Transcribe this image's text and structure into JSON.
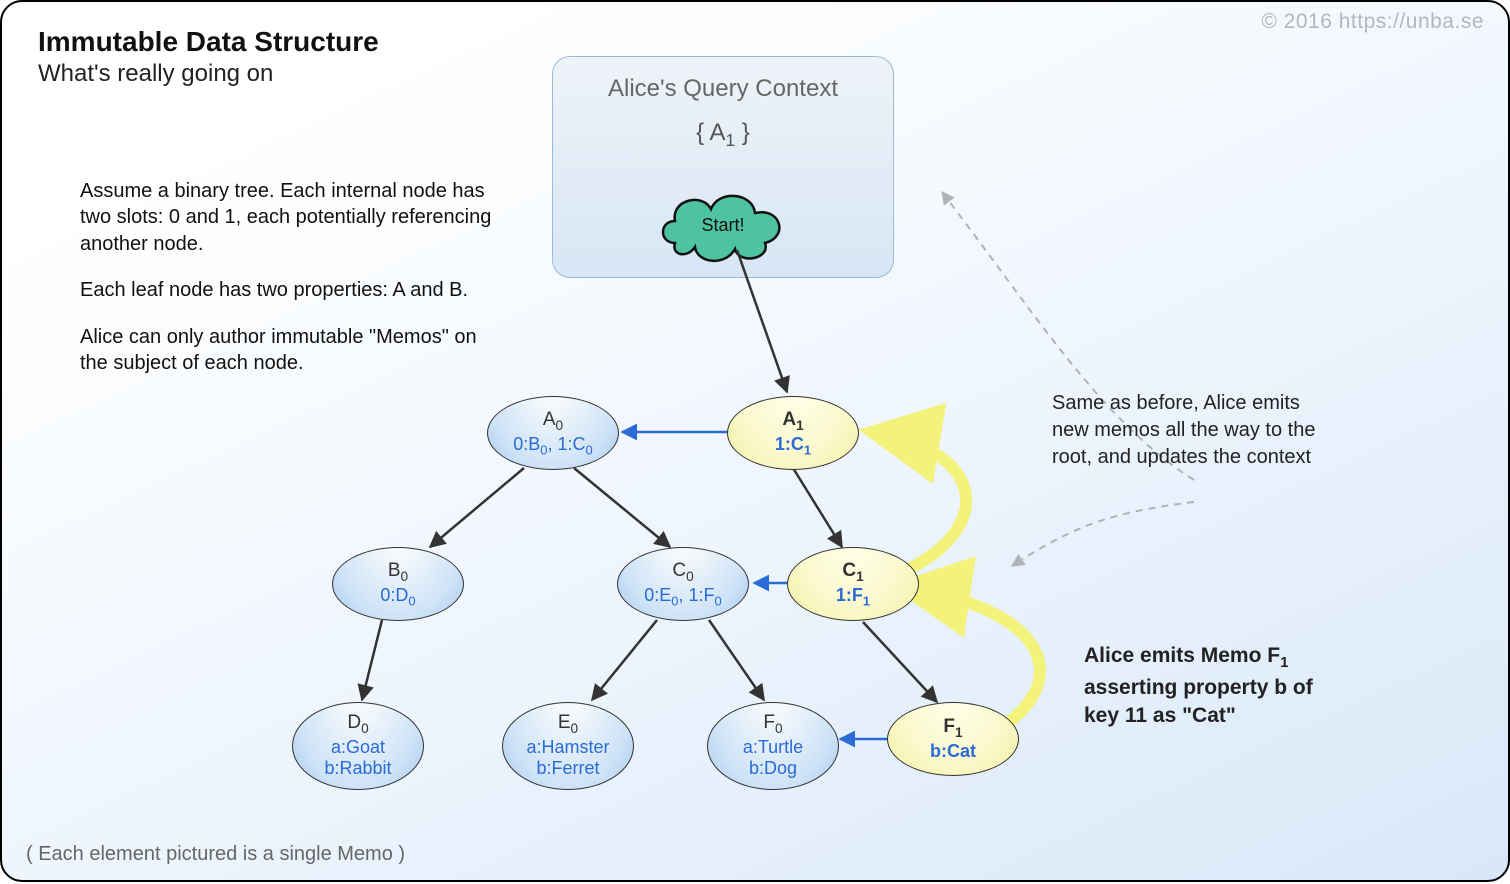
{
  "copyright": "© 2016  https://unba.se",
  "title": "Immutable Data Structure",
  "subtitle": "What's really going on",
  "desc": {
    "p1": "Assume a binary tree. Each internal node has two slots: 0 and 1, each potentially referencing another node.",
    "p2": "Each leaf node has two properties: A and B.",
    "p3": "Alice can only author immutable \"Memos\" on the subject of each node."
  },
  "footnote": "( Each element pictured is a single Memo )",
  "query_context": {
    "title": "Alice's Query Context",
    "set_html": "{ A<sub>1</sub> }",
    "start_label": "Start!"
  },
  "nodes": {
    "a0": {
      "label_html": "A<sub>0</sub>",
      "sub_html": "0:B<sub>0</sub>, 1:C<sub>0</sub>"
    },
    "a1": {
      "label_html": "A<sub>1</sub>",
      "sub_html": "1:C<sub>1</sub>"
    },
    "b0": {
      "label_html": "B<sub>0</sub>",
      "sub_html": "0:D<sub>0</sub>"
    },
    "c0": {
      "label_html": "C<sub>0</sub>",
      "sub_html": "0:E<sub>0</sub>, 1:F<sub>0</sub>"
    },
    "c1": {
      "label_html": "C<sub>1</sub>",
      "sub_html": "1:F<sub>1</sub>"
    },
    "d0": {
      "label_html": "D<sub>0</sub>",
      "sub_html": "a:Goat b:Rabbit"
    },
    "e0": {
      "label_html": "E<sub>0</sub>",
      "sub_html": "a:Hamster b:Ferret"
    },
    "f0": {
      "label_html": "F<sub>0</sub>",
      "sub_html": "a:Turtle b:Dog"
    },
    "f1": {
      "label_html": "F<sub>1</sub>",
      "sub_html": "b:Cat"
    }
  },
  "notes": {
    "same": "Same as before, Alice emits new memos all the way to the root, and updates the context",
    "emit_html": "Alice emits Memo F<sub>1</sub> asserting property b of key 11 as \"Cat\""
  },
  "colors": {
    "edge": "#333333",
    "blue": "#2a6bd6",
    "yellow_glow": "#f3f27a",
    "dash": "#aeb4b9",
    "cloud_fill": "#4ec3a0",
    "cloud_stroke": "#111111"
  }
}
